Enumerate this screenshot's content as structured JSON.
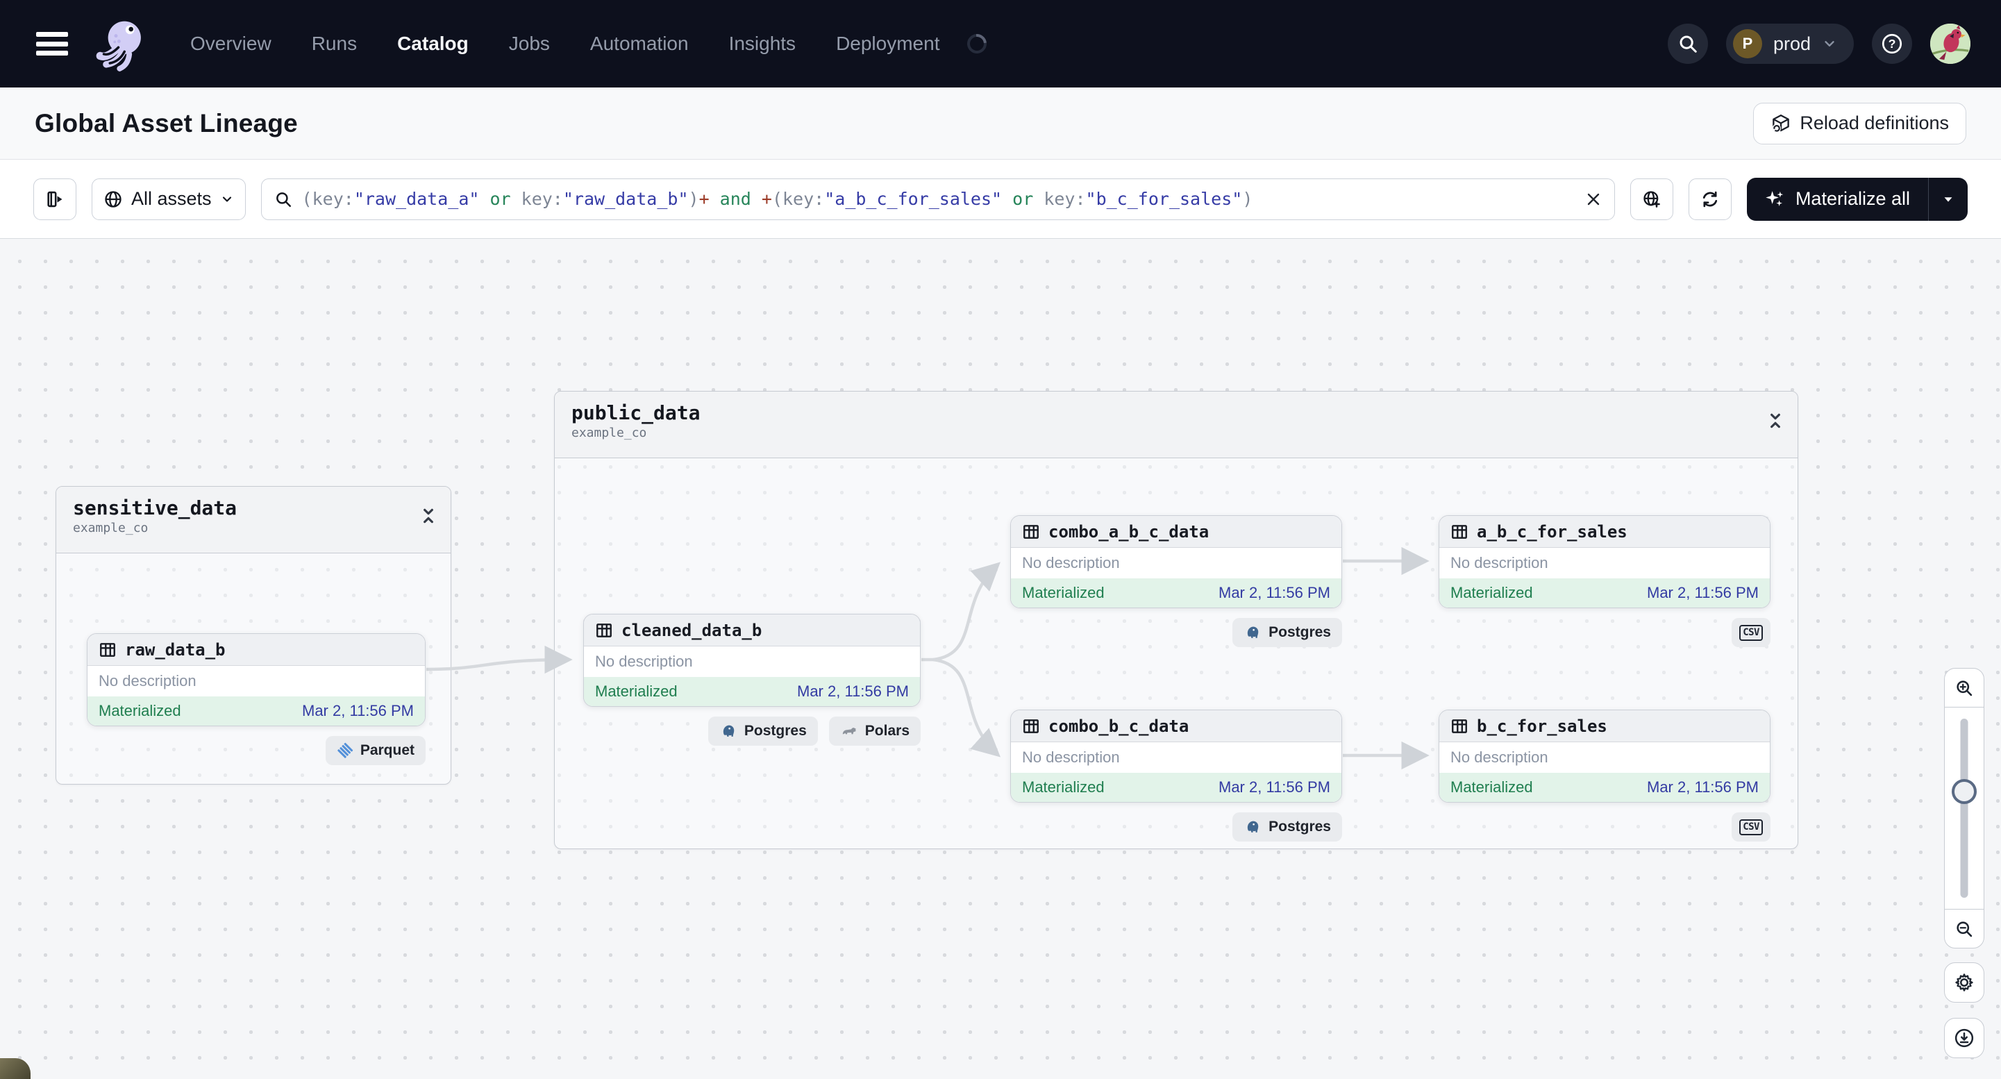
{
  "nav": {
    "items": [
      {
        "label": "Overview",
        "active": false
      },
      {
        "label": "Runs",
        "active": false
      },
      {
        "label": "Catalog",
        "active": true
      },
      {
        "label": "Jobs",
        "active": false
      },
      {
        "label": "Automation",
        "active": false
      },
      {
        "label": "Insights",
        "active": false
      },
      {
        "label": "Deployment",
        "active": false
      }
    ],
    "environment": {
      "initial": "P",
      "name": "prod"
    }
  },
  "header": {
    "title": "Global Asset Lineage",
    "reload_button_label": "Reload definitions"
  },
  "toolbar": {
    "scope_button_label": "All assets",
    "materialize_button_label": "Materialize all",
    "query": {
      "full_text": "(key:\"raw_data_a\" or key:\"raw_data_b\")+ and +(key:\"a_b_c_for_sales\" or key:\"b_c_for_sales\")",
      "segments": [
        {
          "t": "(key:",
          "c": "p"
        },
        {
          "t": "\"raw_data_a\"",
          "c": "s"
        },
        {
          "t": " or ",
          "c": "k"
        },
        {
          "t": "key:",
          "c": "p"
        },
        {
          "t": "\"raw_data_b\"",
          "c": "s"
        },
        {
          "t": ")",
          "c": "p"
        },
        {
          "t": "+",
          "c": "o"
        },
        {
          "t": " and ",
          "c": "k"
        },
        {
          "t": "+",
          "c": "o"
        },
        {
          "t": "(key:",
          "c": "p"
        },
        {
          "t": "\"a_b_c_for_sales\"",
          "c": "s"
        },
        {
          "t": " or ",
          "c": "k"
        },
        {
          "t": "key:",
          "c": "p"
        },
        {
          "t": "\"b_c_for_sales\"",
          "c": "s"
        },
        {
          "t": ")",
          "c": "p"
        }
      ]
    }
  },
  "graph": {
    "groups": [
      {
        "name": "sensitive_data",
        "repo": "example_co"
      },
      {
        "name": "public_data",
        "repo": "example_co"
      }
    ],
    "nodes": [
      {
        "title": "raw_data_b",
        "description": "No description",
        "status": "Materialized",
        "timestamp": "Mar 2, 11:56 PM",
        "badges": [
          {
            "icon": "parquet",
            "label": "Parquet"
          }
        ]
      },
      {
        "title": "cleaned_data_b",
        "description": "No description",
        "status": "Materialized",
        "timestamp": "Mar 2, 11:56 PM",
        "badges": [
          {
            "icon": "postgres",
            "label": "Postgres"
          },
          {
            "icon": "polars",
            "label": "Polars"
          }
        ]
      },
      {
        "title": "combo_a_b_c_data",
        "description": "No description",
        "status": "Materialized",
        "timestamp": "Mar 2, 11:56 PM",
        "badges": [
          {
            "icon": "postgres",
            "label": "Postgres"
          }
        ]
      },
      {
        "title": "a_b_c_for_sales",
        "description": "No description",
        "status": "Materialized",
        "timestamp": "Mar 2, 11:56 PM",
        "badges": [
          {
            "icon": "csv",
            "icon_text": "CSV",
            "label": ""
          }
        ]
      },
      {
        "title": "combo_b_c_data",
        "description": "No description",
        "status": "Materialized",
        "timestamp": "Mar 2, 11:56 PM",
        "badges": [
          {
            "icon": "postgres",
            "label": "Postgres"
          }
        ]
      },
      {
        "title": "b_c_for_sales",
        "description": "No description",
        "status": "Materialized",
        "timestamp": "Mar 2, 11:56 PM",
        "badges": [
          {
            "icon": "csv",
            "icon_text": "CSV",
            "label": ""
          }
        ]
      }
    ]
  },
  "colors": {
    "nav_background": "#0d101d",
    "materialized_text": "#1f7e4f",
    "materialized_background": "#e2f3e9",
    "timestamp_text": "#333ba3",
    "edge": "#d4d7db",
    "query_string": "#363ca6",
    "query_keyword": "#27855a",
    "query_operator": "#9c3b28"
  }
}
